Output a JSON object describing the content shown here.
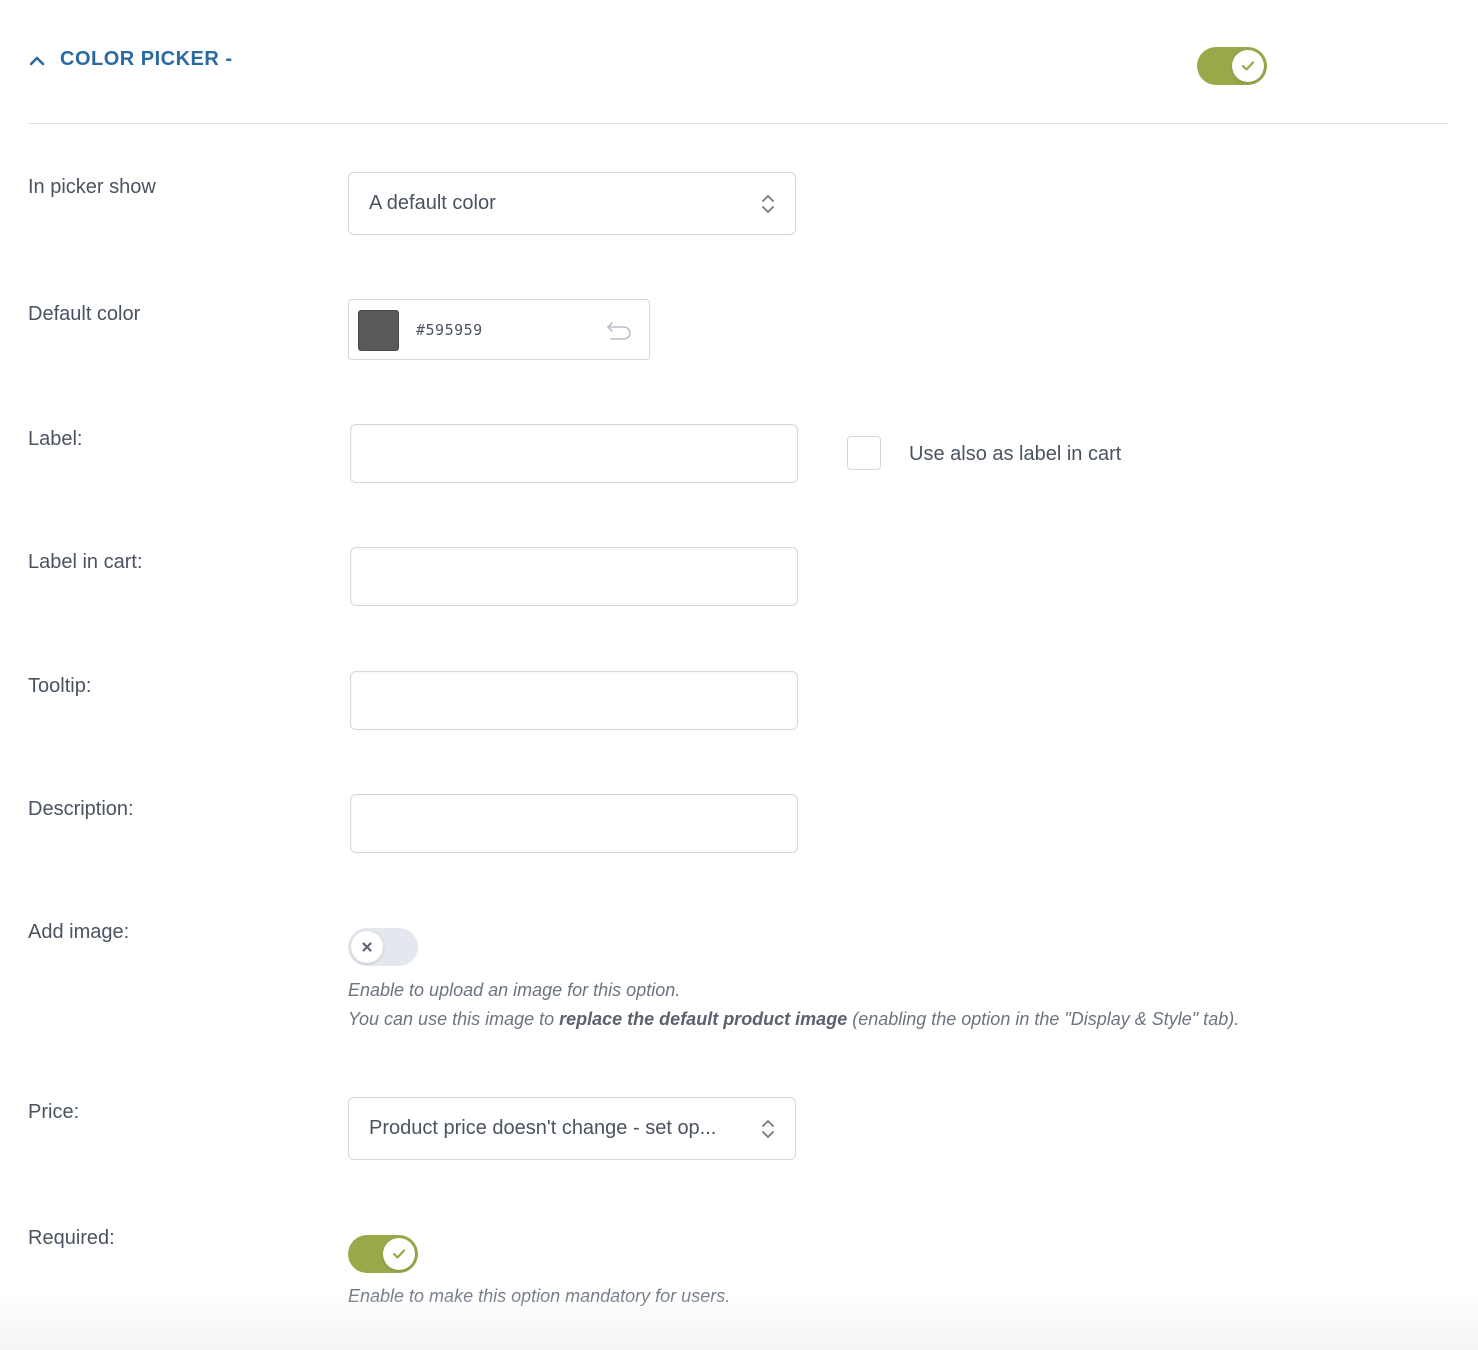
{
  "header": {
    "title": "COLOR PICKER -",
    "enabled": true
  },
  "fields": {
    "picker_show": {
      "label": "In picker show",
      "value": "A default color"
    },
    "default_color": {
      "label": "Default color",
      "value": "#595959",
      "swatch_color": "#595959"
    },
    "label": {
      "label": "Label:",
      "value": "",
      "checkbox_label": "Use also as label in cart",
      "checkbox_checked": false
    },
    "label_in_cart": {
      "label": "Label in cart:",
      "value": ""
    },
    "tooltip": {
      "label": "Tooltip:",
      "value": ""
    },
    "description": {
      "label": "Description:",
      "value": ""
    },
    "add_image": {
      "label": "Add image:",
      "enabled": false,
      "help_line1": "Enable to upload an image for this option.",
      "help_line2_prefix": "You can use this image to ",
      "help_line2_bold": "replace the default product image",
      "help_line2_suffix": " (enabling the option in the \"Display & Style\" tab)."
    },
    "price": {
      "label": "Price:",
      "value": "Product price doesn't change - set op..."
    },
    "required": {
      "label": "Required:",
      "enabled": true,
      "help": "Enable to make this option mandatory for users."
    }
  },
  "colors": {
    "accent_blue": "#2a6aa0",
    "toggle_on": "#9aa84a",
    "toggle_off": "#e3e7ee"
  },
  "icons": {
    "collapse": "chevron-up-icon",
    "toggle_on": "check-icon",
    "toggle_off": "x-icon",
    "select": "updown-chevron-icon",
    "reset": "undo-icon"
  }
}
